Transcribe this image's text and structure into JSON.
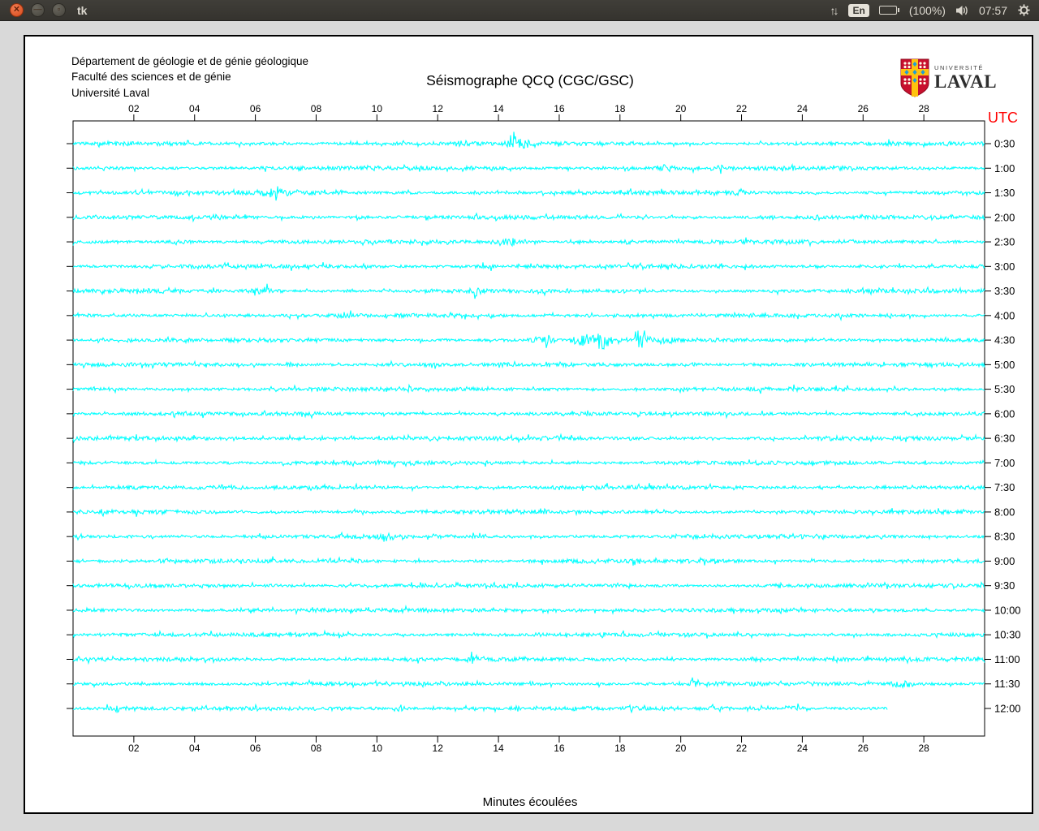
{
  "panel": {
    "window_title": "tk",
    "buttons": {
      "close": "✕",
      "minimize": "−",
      "maximize": "▫"
    },
    "indicators": {
      "keyboard_layout": "En",
      "battery_percent": "(100%)",
      "clock": "07:57"
    }
  },
  "header": {
    "line1": "Département de géologie et de génie géologique",
    "line2": "Faculté des sciences et de génie",
    "line3": "Université Laval",
    "title": "Séismographe QCQ (CGC/GSC)",
    "logo_top": "UNIVERSITÉ",
    "logo_bottom": "LAVAL"
  },
  "plot": {
    "utc_label": "UTC",
    "x_axis_title": "Minutes écoulées",
    "x_tick_labels": [
      "02",
      "04",
      "06",
      "08",
      "10",
      "12",
      "14",
      "16",
      "18",
      "20",
      "22",
      "24",
      "26",
      "28"
    ],
    "x_range_minutes": [
      0,
      30
    ],
    "trace_color": "#00ffff",
    "utc_color": "#ff0000"
  },
  "chart_data": {
    "type": "line",
    "title": "Séismographe QCQ (CGC/GSC)",
    "xlabel": "Minutes écoulées",
    "x_range": [
      0,
      30
    ],
    "x_ticks": [
      2,
      4,
      6,
      8,
      10,
      12,
      14,
      16,
      18,
      20,
      22,
      24,
      26,
      28
    ],
    "legend_position": "right",
    "grid": false,
    "series_note": "24 half-hour helicorder noise traces, one per UTC label; last trace (12:00) is partial",
    "rows": [
      {
        "label": "0:30",
        "end_minute": 30,
        "events": [
          {
            "m": 14.6,
            "w": 0.5,
            "a": 3.5
          },
          {
            "m": 18.2,
            "w": 0.3,
            "a": 2.0
          }
        ]
      },
      {
        "label": "1:00",
        "end_minute": 30,
        "events": [
          {
            "m": 18.2,
            "w": 0.3,
            "a": 2.6
          },
          {
            "m": 19.5,
            "w": 0.3,
            "a": 2.6
          },
          {
            "m": 21.3,
            "w": 0.2,
            "a": 2.0
          }
        ]
      },
      {
        "label": "1:30",
        "end_minute": 30,
        "events": [
          {
            "m": 6.6,
            "w": 0.7,
            "a": 2.6
          },
          {
            "m": 13.3,
            "w": 0.3,
            "a": 2.0
          },
          {
            "m": 21.9,
            "w": 0.3,
            "a": 2.2
          }
        ]
      },
      {
        "label": "2:00",
        "end_minute": 30,
        "events": [
          {
            "m": 4.7,
            "w": 0.4,
            "a": 2.4
          },
          {
            "m": 9.5,
            "w": 0.3,
            "a": 2.2
          },
          {
            "m": 24.5,
            "w": 0.3,
            "a": 2.0
          }
        ]
      },
      {
        "label": "2:30",
        "end_minute": 30,
        "events": [
          {
            "m": 3.5,
            "w": 0.7,
            "a": 2.2
          },
          {
            "m": 14.5,
            "w": 0.6,
            "a": 3.0
          },
          {
            "m": 18.2,
            "w": 0.3,
            "a": 2.2
          }
        ]
      },
      {
        "label": "3:00",
        "end_minute": 30,
        "events": [
          {
            "m": 13.6,
            "w": 0.4,
            "a": 2.4
          },
          {
            "m": 19.0,
            "w": 0.2,
            "a": 2.0
          }
        ]
      },
      {
        "label": "3:30",
        "end_minute": 30,
        "events": [
          {
            "m": 6.3,
            "w": 0.8,
            "a": 2.8
          },
          {
            "m": 13.3,
            "w": 0.5,
            "a": 2.6
          }
        ]
      },
      {
        "label": "4:00",
        "end_minute": 30,
        "events": [
          {
            "m": 9.0,
            "w": 0.2,
            "a": 2.0
          }
        ]
      },
      {
        "label": "4:30",
        "end_minute": 30,
        "events": [
          {
            "m": 15.5,
            "w": 0.6,
            "a": 2.5
          },
          {
            "m": 16.7,
            "w": 0.5,
            "a": 4.5
          },
          {
            "m": 17.4,
            "w": 0.4,
            "a": 6.5
          },
          {
            "m": 18.7,
            "w": 0.25,
            "a": 8.5
          },
          {
            "m": 19.5,
            "w": 0.3,
            "a": 2.5
          }
        ]
      },
      {
        "label": "5:00",
        "end_minute": 30,
        "events": [
          {
            "m": 7.2,
            "w": 0.3,
            "a": 2.2
          },
          {
            "m": 20.5,
            "w": 0.3,
            "a": 2.0
          }
        ]
      },
      {
        "label": "5:30",
        "end_minute": 30,
        "events": [
          {
            "m": 11.0,
            "w": 0.2,
            "a": 1.8
          }
        ]
      },
      {
        "label": "6:00",
        "end_minute": 30,
        "events": []
      },
      {
        "label": "6:30",
        "end_minute": 30,
        "events": [
          {
            "m": 16.0,
            "w": 0.2,
            "a": 1.8
          }
        ]
      },
      {
        "label": "7:00",
        "end_minute": 30,
        "events": []
      },
      {
        "label": "7:30",
        "end_minute": 30,
        "events": [
          {
            "m": 2.0,
            "w": 0.3,
            "a": 1.8
          }
        ]
      },
      {
        "label": "8:00",
        "end_minute": 30,
        "events": []
      },
      {
        "label": "8:30",
        "end_minute": 30,
        "events": [
          {
            "m": 10.3,
            "w": 0.4,
            "a": 3.2
          }
        ]
      },
      {
        "label": "9:00",
        "end_minute": 30,
        "events": []
      },
      {
        "label": "9:30",
        "end_minute": 30,
        "events": []
      },
      {
        "label": "10:00",
        "end_minute": 30,
        "events": []
      },
      {
        "label": "10:30",
        "end_minute": 30,
        "events": []
      },
      {
        "label": "11:00",
        "end_minute": 30,
        "events": [
          {
            "m": 13.2,
            "w": 0.4,
            "a": 2.6
          },
          {
            "m": 22.4,
            "w": 0.4,
            "a": 2.4
          }
        ]
      },
      {
        "label": "11:30",
        "end_minute": 30,
        "events": [
          {
            "m": 20.4,
            "w": 0.3,
            "a": 2.6
          },
          {
            "m": 27.3,
            "w": 0.6,
            "a": 3.2
          }
        ]
      },
      {
        "label": "12:00",
        "end_minute": 26.8,
        "events": [
          {
            "m": 1.4,
            "w": 0.5,
            "a": 2.6
          },
          {
            "m": 10.8,
            "w": 0.3,
            "a": 2.2
          },
          {
            "m": 14.6,
            "w": 0.3,
            "a": 2.2
          },
          {
            "m": 23.7,
            "w": 0.4,
            "a": 2.6
          }
        ]
      }
    ]
  }
}
